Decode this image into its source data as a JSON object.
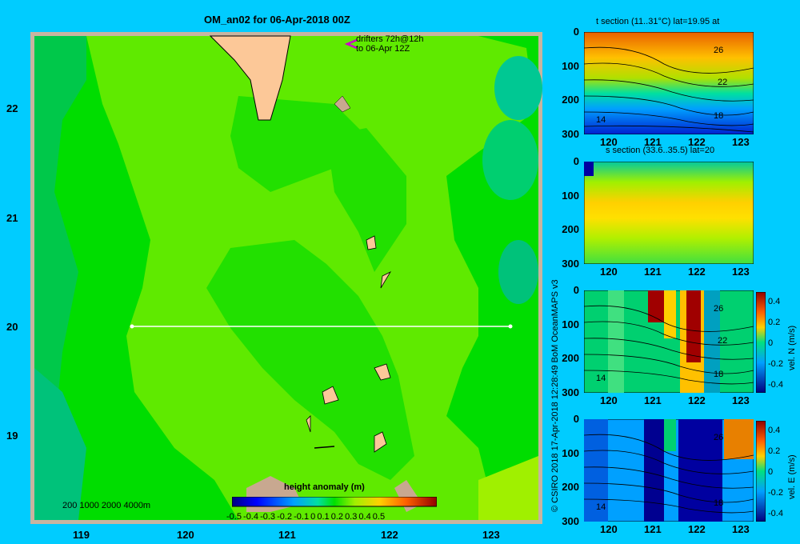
{
  "main_title": "OM_an02 for 06-Apr-2018 00Z",
  "drifters_line1": "drifters 72h@12h",
  "drifters_line2": "to 06-Apr 12Z",
  "depth_legend": "200  1000  2000  4000m",
  "map": {
    "lon_ticks": [
      "119",
      "120",
      "121",
      "122",
      "123"
    ],
    "lat_ticks": [
      "22",
      "21",
      "20",
      "19"
    ]
  },
  "colorbar": {
    "label": "height anomaly  (m)",
    "ticks": [
      "-0.5",
      "-0.4",
      "-0.3",
      "-0.2",
      "-0.1",
      "0",
      "0.1",
      "0.2",
      "0.3",
      "0.4",
      "0.5"
    ]
  },
  "side_caption": "© CSIRO 2018   17-Apr-2018 12:28:49 BoM OceanMAPS v3",
  "panels": [
    {
      "title": "t section (11..31°C) lat=19.95 at",
      "depth_ticks": [
        "0",
        "100",
        "200",
        "300"
      ],
      "lon_ticks": [
        "120",
        "121",
        "122",
        "123"
      ],
      "contours": [
        "26",
        "22",
        "18",
        "14"
      ]
    },
    {
      "title": "s section (33.6..35.5) lat=20",
      "depth_ticks": [
        "0",
        "100",
        "200",
        "300"
      ],
      "lon_ticks": [
        "120",
        "121",
        "122",
        "123"
      ]
    },
    {
      "title": "",
      "depth_ticks": [
        "0",
        "100",
        "200",
        "300"
      ],
      "lon_ticks": [
        "120",
        "121",
        "122",
        "123"
      ],
      "contours": [
        "26",
        "22",
        "18",
        "14"
      ],
      "cbar_ticks": [
        "0.4",
        "0.2",
        "0",
        "-0.2",
        "-0.4"
      ],
      "cbar_label": "vel. N (m/s)"
    },
    {
      "title": "",
      "depth_ticks": [
        "0",
        "100",
        "200",
        "300"
      ],
      "lon_ticks": [
        "120",
        "121",
        "122",
        "123"
      ],
      "contours": [
        "26",
        "18",
        "14"
      ],
      "cbar_ticks": [
        "0.4",
        "0.2",
        "0",
        "-0.2",
        "-0.4"
      ],
      "cbar_label": "vel. E (m/s)"
    }
  ],
  "colors": {
    "background": "#00ccff",
    "land": "#fcc898",
    "frame": "#c8b4a0",
    "sea_green": "#00e000",
    "sea_light": "#66ee00"
  }
}
